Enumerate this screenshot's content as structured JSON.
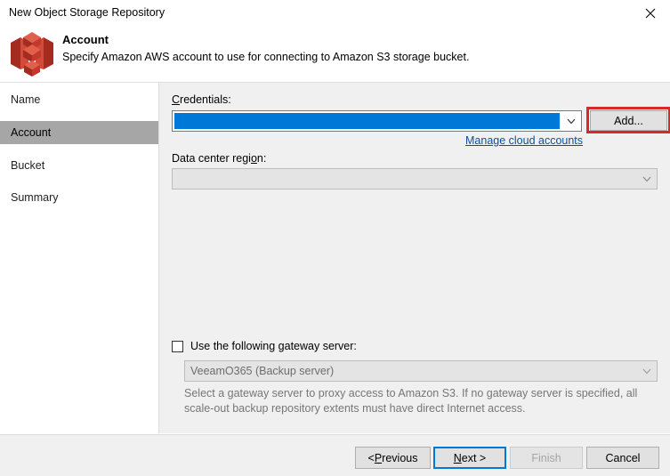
{
  "window": {
    "title": "New Object Storage Repository",
    "close_icon": "close-icon"
  },
  "header": {
    "icon": "aws-s3-bucket-icon",
    "title": "Account",
    "subtitle": "Specify Amazon AWS account to use for connecting to Amazon S3 storage bucket."
  },
  "sidebar": {
    "items": [
      {
        "label": "Name",
        "selected": false
      },
      {
        "label": "Account",
        "selected": true
      },
      {
        "label": "Bucket",
        "selected": false
      },
      {
        "label": "Summary",
        "selected": false
      }
    ]
  },
  "main": {
    "credentials": {
      "label_pre": "",
      "label_accel": "C",
      "label_post": "redentials:",
      "value": "",
      "arrow_icon": "chevron-down-icon",
      "add_button": "Add...",
      "add_button_accel": "d",
      "manage_link": "Manage cloud accounts"
    },
    "region": {
      "label_pre": "Data center regi",
      "label_accel": "o",
      "label_post": "n:",
      "value": "",
      "arrow_icon": "chevron-down-icon"
    },
    "gateway": {
      "checkbox_label": "Use the following gateway server:",
      "checked": false,
      "server_value": "VeeamO365 (Backup server)",
      "arrow_icon": "chevron-down-icon",
      "hint": "Select a gateway server to proxy access to Amazon S3. If no gateway server is specified, all scale-out backup repository extents must have direct Internet access."
    }
  },
  "footer": {
    "previous_pre": "< ",
    "previous_accel": "P",
    "previous_post": "revious",
    "next_pre": "",
    "next_accel": "N",
    "next_post": "ext >",
    "finish": "Finish",
    "cancel": "Cancel"
  },
  "colors": {
    "accent_blue": "#0078d7",
    "annotation_red": "#d42a2a",
    "link_blue": "#0b4f9c",
    "selected_nav": "#a6a6a6",
    "body_gray": "#f0f0f0",
    "s3_red": "#c9362a"
  }
}
